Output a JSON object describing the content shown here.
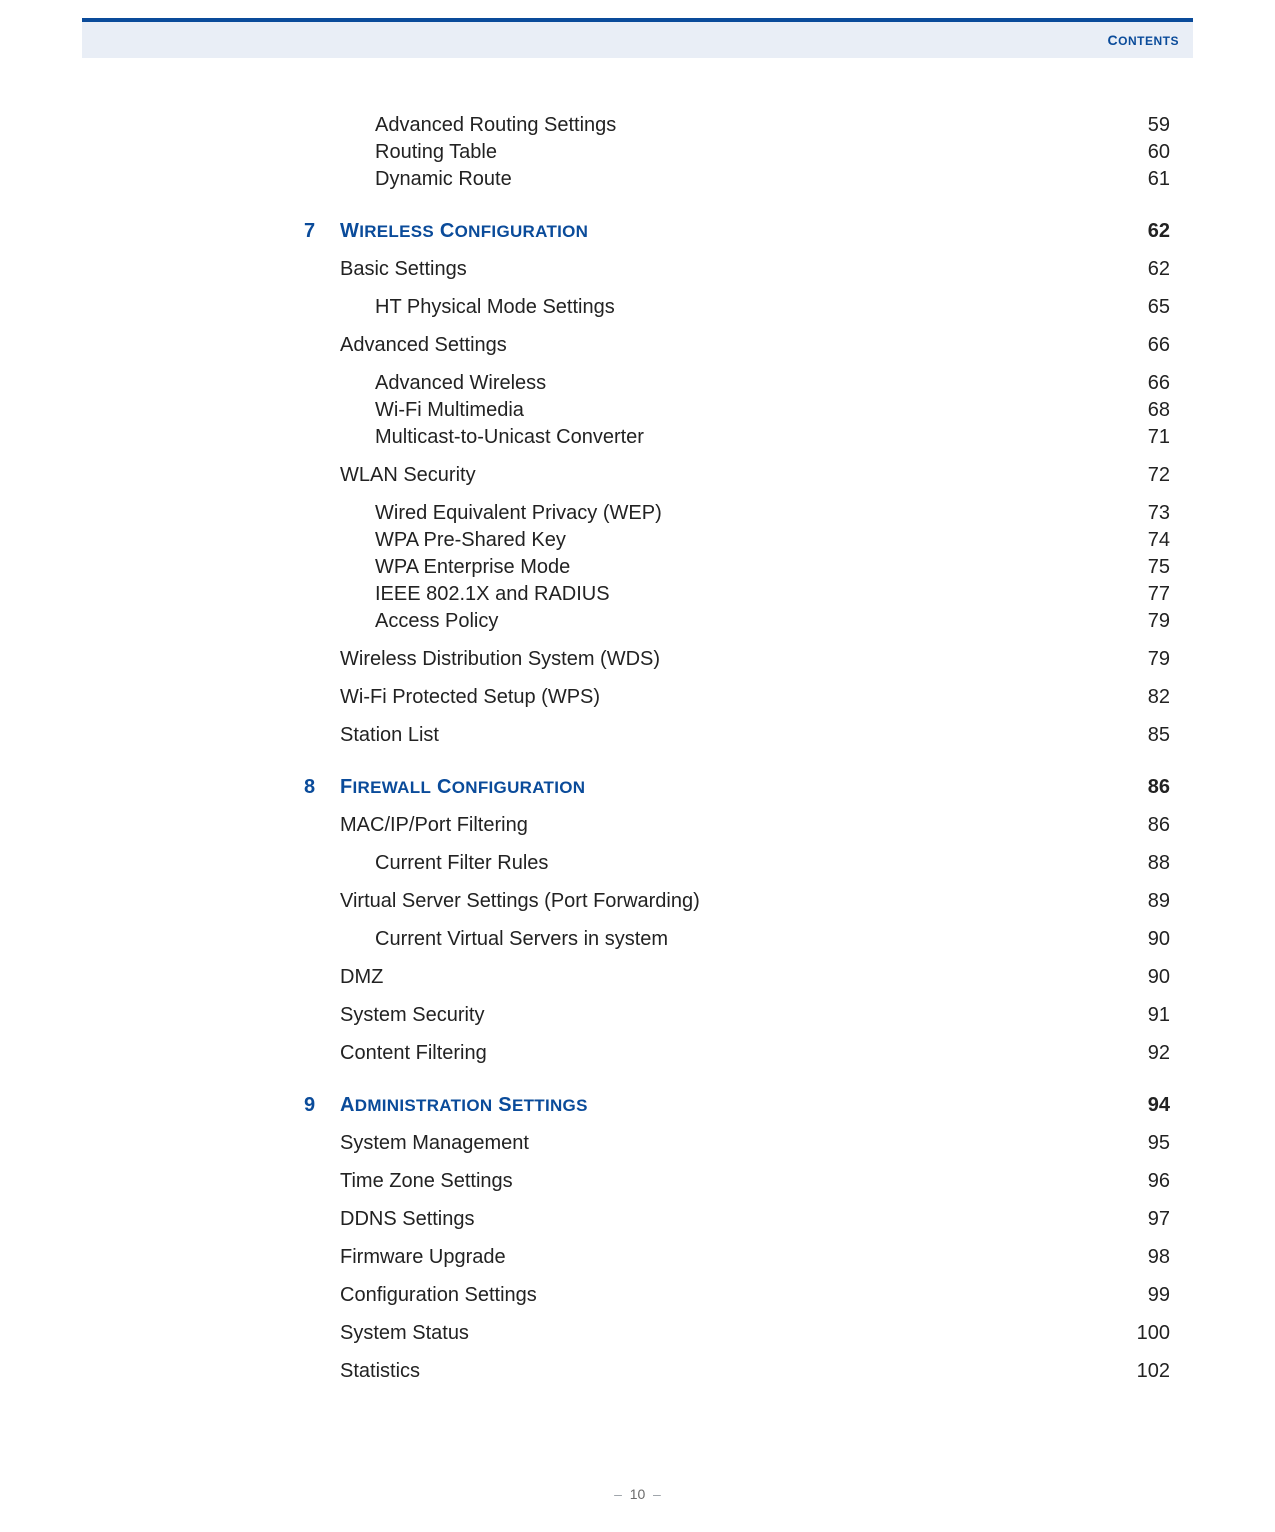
{
  "header": {
    "title": "Contents"
  },
  "footer": {
    "page": "10"
  },
  "entries": [
    {
      "level": 2,
      "label": "Advanced Routing Settings",
      "page": "59"
    },
    {
      "level": 2,
      "label": "Routing Table",
      "page": "60"
    },
    {
      "level": 2,
      "label": "Dynamic Route",
      "page": "61"
    },
    {
      "level": 0,
      "num": "7",
      "label": "Wireless Configuration",
      "page": "62"
    },
    {
      "level": 1,
      "label": "Basic Settings",
      "page": "62"
    },
    {
      "level": 2,
      "label": "HT Physical Mode Settings",
      "page": "65"
    },
    {
      "level": 1,
      "label": "Advanced Settings",
      "page": "66"
    },
    {
      "level": 2,
      "label": "Advanced Wireless",
      "page": "66"
    },
    {
      "level": 2,
      "label": "Wi-Fi Multimedia",
      "page": "68"
    },
    {
      "level": 2,
      "label": "Multicast-to-Unicast Converter",
      "page": "71"
    },
    {
      "level": 1,
      "label": "WLAN Security",
      "page": "72"
    },
    {
      "level": 2,
      "label": "Wired Equivalent Privacy (WEP)",
      "page": "73"
    },
    {
      "level": 2,
      "label": "WPA Pre-Shared Key",
      "page": "74"
    },
    {
      "level": 2,
      "label": "WPA Enterprise Mode",
      "page": "75"
    },
    {
      "level": 2,
      "label": "IEEE 802.1X and RADIUS",
      "page": "77"
    },
    {
      "level": 2,
      "label": "Access Policy",
      "page": "79"
    },
    {
      "level": 1,
      "label": "Wireless Distribution System (WDS)",
      "page": "79"
    },
    {
      "level": 1,
      "label": "Wi-Fi Protected Setup (WPS)",
      "page": "82"
    },
    {
      "level": 1,
      "label": "Station List",
      "page": "85"
    },
    {
      "level": 0,
      "num": "8",
      "label": "Firewall Configuration",
      "page": "86"
    },
    {
      "level": 1,
      "label": "MAC/IP/Port Filtering",
      "page": "86"
    },
    {
      "level": 2,
      "label": "Current Filter Rules",
      "page": "88"
    },
    {
      "level": 1,
      "label": "Virtual Server Settings (Port Forwarding)",
      "page": "89"
    },
    {
      "level": 2,
      "label": "Current Virtual Servers in system",
      "page": "90"
    },
    {
      "level": 1,
      "label": "DMZ",
      "page": "90"
    },
    {
      "level": 1,
      "label": "System Security",
      "page": "91"
    },
    {
      "level": 1,
      "label": "Content Filtering",
      "page": "92"
    },
    {
      "level": 0,
      "num": "9",
      "label": "Administration Settings",
      "page": "94"
    },
    {
      "level": 1,
      "label": "System Management",
      "page": "95"
    },
    {
      "level": 1,
      "label": "Time Zone Settings",
      "page": "96"
    },
    {
      "level": 1,
      "label": "DDNS Settings",
      "page": "97"
    },
    {
      "level": 1,
      "label": "Firmware Upgrade",
      "page": "98"
    },
    {
      "level": 1,
      "label": "Configuration Settings",
      "page": "99"
    },
    {
      "level": 1,
      "label": "System Status",
      "page": "100"
    },
    {
      "level": 1,
      "label": "Statistics",
      "page": "102"
    }
  ]
}
